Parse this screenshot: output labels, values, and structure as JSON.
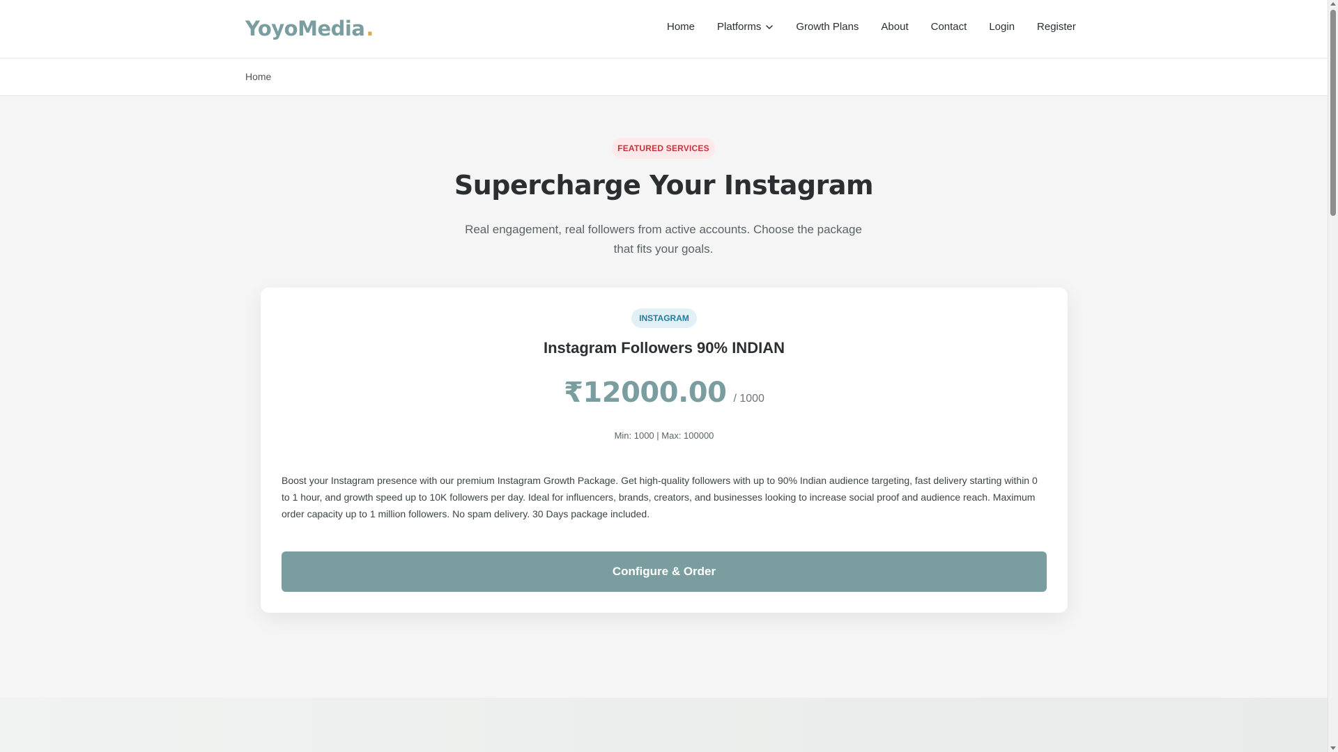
{
  "header": {
    "logo": "YoyoMedia",
    "logo_dot": ".",
    "nav": {
      "home": "Home",
      "platforms": "Platforms",
      "growth_plans": "Growth Plans",
      "about": "About",
      "contact": "Contact",
      "login": "Login",
      "register": "Register"
    }
  },
  "breadcrumb": {
    "home": "Home"
  },
  "hero": {
    "badge": "FEATURED SERVICES",
    "title": "Supercharge Your Instagram",
    "subtitle": "Real engagement, real followers from active accounts. Choose the package that fits your goals."
  },
  "card": {
    "platform_badge": "INSTAGRAM",
    "title": "Instagram Followers 90% INDIAN",
    "price": "₹12000.00",
    "per_unit": "/ 1000",
    "minmax": "Min: 1000 | Max: 100000",
    "description": "Boost your Instagram presence with our premium Instagram Growth Package. Get high-quality followers with up to 90% Indian audience targeting, fast delivery starting within 0 to 1 hour, and growth speed up to 10K followers per day. Ideal for influencers, brands, creators, and businesses looking to increase social proof and audience reach. Maximum order capacity up to 1 million followers. No spam delivery. 30 Days package included.",
    "button": "Configure & Order"
  },
  "colors": {
    "accent": "#7a9e9f",
    "logo_dot": "#e3a55a",
    "featured_badge_text": "#c8323c",
    "platform_badge_text": "#247ba0"
  },
  "icons": {
    "platforms_dropdown": "chevron-down-icon"
  }
}
